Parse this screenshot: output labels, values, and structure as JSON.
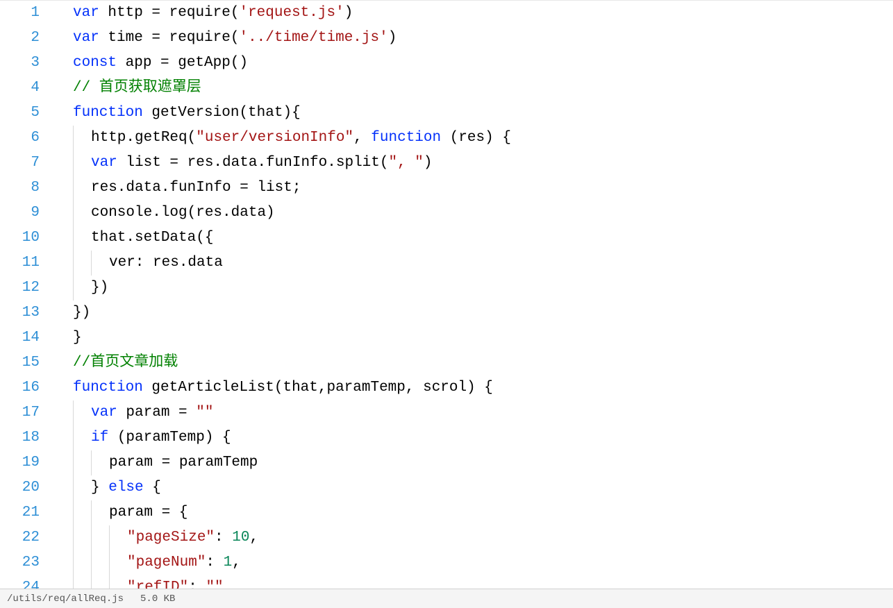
{
  "statusbar": {
    "path": "/utils/req/allReq.js",
    "size": "5.0 KB"
  },
  "lines": [
    {
      "n": 1,
      "indent": 0,
      "tokens": [
        {
          "t": "var",
          "c": "kw"
        },
        {
          "t": " http = ",
          "c": "ident"
        },
        {
          "t": "require",
          "c": "ident"
        },
        {
          "t": "(",
          "c": "punc"
        },
        {
          "t": "'request.js'",
          "c": "str"
        },
        {
          "t": ")",
          "c": "punc"
        }
      ]
    },
    {
      "n": 2,
      "indent": 0,
      "tokens": [
        {
          "t": "var",
          "c": "kw"
        },
        {
          "t": " time = ",
          "c": "ident"
        },
        {
          "t": "require",
          "c": "ident"
        },
        {
          "t": "(",
          "c": "punc"
        },
        {
          "t": "'../time/time.js'",
          "c": "str"
        },
        {
          "t": ")",
          "c": "punc"
        }
      ]
    },
    {
      "n": 3,
      "indent": 0,
      "tokens": [
        {
          "t": "const",
          "c": "kw"
        },
        {
          "t": " app = getApp()",
          "c": "ident"
        }
      ]
    },
    {
      "n": 4,
      "indent": 0,
      "tokens": [
        {
          "t": "// 首页获取遮罩层",
          "c": "comment"
        }
      ]
    },
    {
      "n": 5,
      "indent": 0,
      "tokens": [
        {
          "t": "function",
          "c": "kw"
        },
        {
          "t": " getVersion(that){",
          "c": "ident"
        }
      ]
    },
    {
      "n": 6,
      "indent": 1,
      "guides": [
        0
      ],
      "tokens": [
        {
          "t": "http.getReq(",
          "c": "ident"
        },
        {
          "t": "\"user/versionInfo\"",
          "c": "str"
        },
        {
          "t": ", ",
          "c": "punc"
        },
        {
          "t": "function",
          "c": "kw"
        },
        {
          "t": " (res) {",
          "c": "ident"
        }
      ]
    },
    {
      "n": 7,
      "indent": 1,
      "guides": [
        0
      ],
      "tokens": [
        {
          "t": "var",
          "c": "kw"
        },
        {
          "t": " list = res.data.funInfo.split(",
          "c": "ident"
        },
        {
          "t": "\", \"",
          "c": "str"
        },
        {
          "t": ")",
          "c": "ident"
        }
      ]
    },
    {
      "n": 8,
      "indent": 1,
      "guides": [
        0
      ],
      "tokens": [
        {
          "t": "res.data.funInfo = list;",
          "c": "ident"
        }
      ]
    },
    {
      "n": 9,
      "indent": 1,
      "guides": [
        0
      ],
      "tokens": [
        {
          "t": "console.log(res.data)",
          "c": "ident"
        }
      ]
    },
    {
      "n": 10,
      "indent": 1,
      "guides": [
        0
      ],
      "tokens": [
        {
          "t": "that.setData({",
          "c": "ident"
        }
      ]
    },
    {
      "n": 11,
      "indent": 2,
      "guides": [
        0,
        1
      ],
      "tokens": [
        {
          "t": "ver: res.data",
          "c": "ident"
        }
      ]
    },
    {
      "n": 12,
      "indent": 1,
      "guides": [
        0
      ],
      "tokens": [
        {
          "t": "})",
          "c": "ident"
        }
      ]
    },
    {
      "n": 13,
      "indent": 0,
      "tokens": [
        {
          "t": "})",
          "c": "ident"
        }
      ]
    },
    {
      "n": 14,
      "indent": 0,
      "tokens": [
        {
          "t": "}",
          "c": "ident"
        }
      ]
    },
    {
      "n": 15,
      "indent": 0,
      "tokens": [
        {
          "t": "//首页文章加载",
          "c": "comment"
        }
      ]
    },
    {
      "n": 16,
      "indent": 0,
      "tokens": [
        {
          "t": "function",
          "c": "kw"
        },
        {
          "t": " getArticleList(that,paramTemp, scrol) {",
          "c": "ident"
        }
      ]
    },
    {
      "n": 17,
      "indent": 1,
      "guides": [
        0
      ],
      "tokens": [
        {
          "t": "var",
          "c": "kw"
        },
        {
          "t": " param = ",
          "c": "ident"
        },
        {
          "t": "\"\"",
          "c": "str"
        }
      ]
    },
    {
      "n": 18,
      "indent": 1,
      "guides": [
        0
      ],
      "tokens": [
        {
          "t": "if",
          "c": "kw"
        },
        {
          "t": " (paramTemp) {",
          "c": "ident"
        }
      ]
    },
    {
      "n": 19,
      "indent": 2,
      "guides": [
        0,
        1
      ],
      "tokens": [
        {
          "t": "param = paramTemp",
          "c": "ident"
        }
      ]
    },
    {
      "n": 20,
      "indent": 1,
      "guides": [
        0
      ],
      "tokens": [
        {
          "t": "} ",
          "c": "ident"
        },
        {
          "t": "else",
          "c": "kw"
        },
        {
          "t": " {",
          "c": "ident"
        }
      ]
    },
    {
      "n": 21,
      "indent": 2,
      "guides": [
        0,
        1
      ],
      "tokens": [
        {
          "t": "param = {",
          "c": "ident"
        }
      ]
    },
    {
      "n": 22,
      "indent": 3,
      "guides": [
        0,
        1,
        2
      ],
      "tokens": [
        {
          "t": "\"pageSize\"",
          "c": "str"
        },
        {
          "t": ": ",
          "c": "punc"
        },
        {
          "t": "10",
          "c": "num"
        },
        {
          "t": ",",
          "c": "punc"
        }
      ]
    },
    {
      "n": 23,
      "indent": 3,
      "guides": [
        0,
        1,
        2
      ],
      "tokens": [
        {
          "t": "\"pageNum\"",
          "c": "str"
        },
        {
          "t": ": ",
          "c": "punc"
        },
        {
          "t": "1",
          "c": "num"
        },
        {
          "t": ",",
          "c": "punc"
        }
      ]
    },
    {
      "n": 24,
      "indent": 3,
      "guides": [
        0,
        1,
        2
      ],
      "tokens": [
        {
          "t": "\"refID\"",
          "c": "str"
        },
        {
          "t": ": ",
          "c": "punc"
        },
        {
          "t": "\"\"",
          "c": "str"
        },
        {
          "t": ",",
          "c": "punc"
        }
      ]
    }
  ]
}
